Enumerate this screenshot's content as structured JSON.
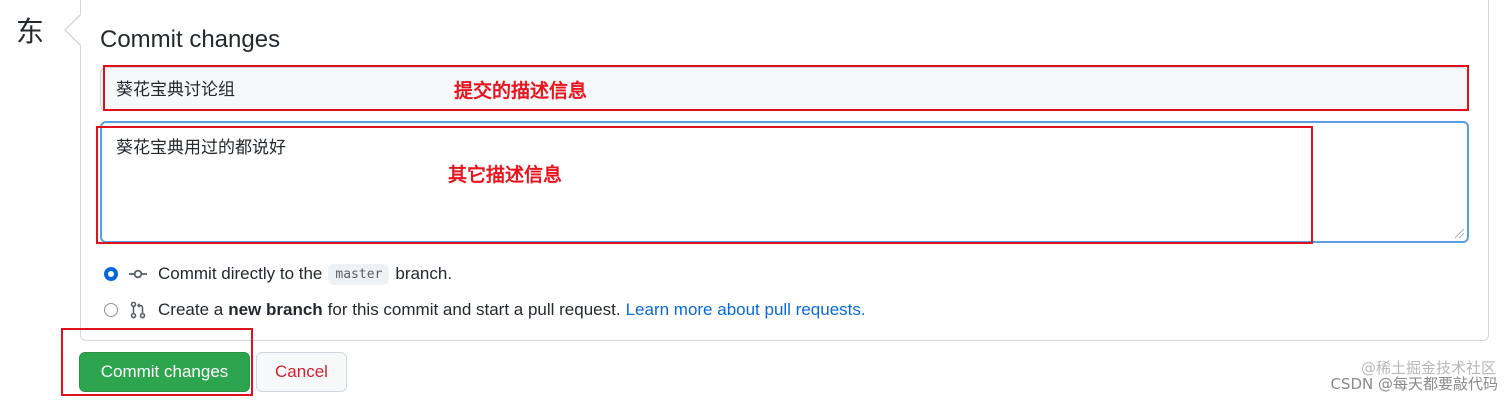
{
  "avatar_char": "东",
  "panel": {
    "title": "Commit changes",
    "summary_value": "葵花宝典讨论组",
    "description_value": "葵花宝典用过的都说好"
  },
  "annotations": {
    "summary_note": "提交的描述信息",
    "description_note": "其它描述信息"
  },
  "options": {
    "direct": {
      "text_before": "Commit directly to the",
      "branch": "master",
      "text_after": "branch."
    },
    "new_branch": {
      "text_before": "Create a",
      "bold": "new branch",
      "text_after": "for this commit and start a pull request.",
      "link": "Learn more about pull requests."
    }
  },
  "buttons": {
    "commit": "Commit changes",
    "cancel": "Cancel"
  },
  "watermark": {
    "line1": "@稀土掘金技术社区",
    "line2": "CSDN @每天都要敲代码"
  },
  "colors": {
    "primary": "#2da44e",
    "link": "#0969da",
    "annotation": "#e0101c",
    "cancel_text": "#cf222e"
  }
}
